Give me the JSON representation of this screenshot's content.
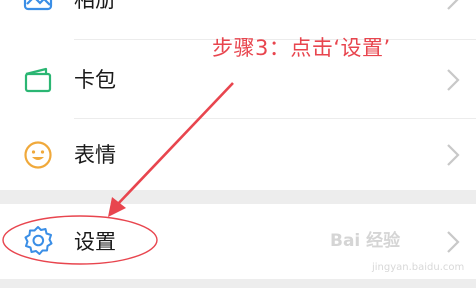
{
  "menu": {
    "items": [
      {
        "label": "相册",
        "icon": "image-icon"
      },
      {
        "label": "卡包",
        "icon": "wallet-icon"
      },
      {
        "label": "表情",
        "icon": "smiley-icon"
      },
      {
        "label": "设置",
        "icon": "gear-icon"
      }
    ]
  },
  "annotation": {
    "step_text": "步骤3：点击‘设置’",
    "color": "#e8454e"
  },
  "watermark": {
    "brand": "Bai 经验",
    "sub": "jingyan.baidu.com"
  },
  "colors": {
    "accent_blue": "#3a8ee6",
    "icon_green": "#2bb673",
    "icon_orange": "#f0a93b",
    "background": "#ededed"
  }
}
